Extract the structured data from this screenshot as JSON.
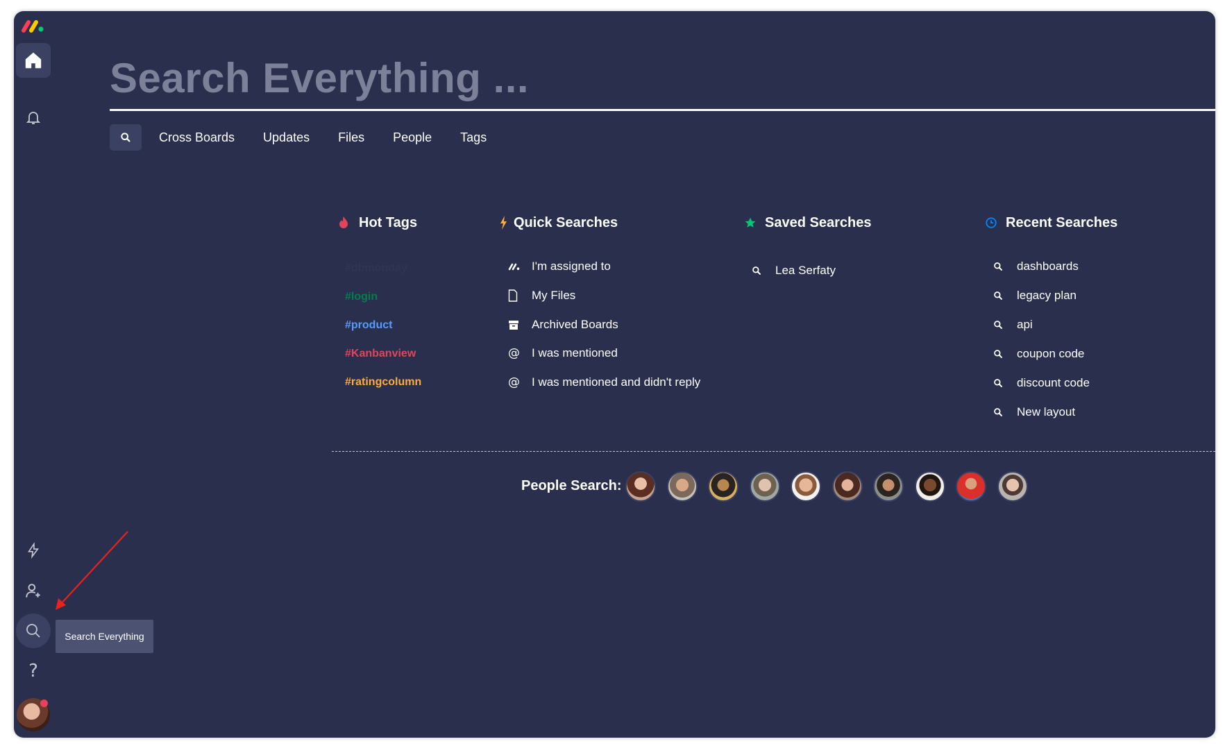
{
  "search": {
    "title": "Search Everything ..."
  },
  "filters": {
    "tabs": [
      "Cross Boards",
      "Updates",
      "Files",
      "People",
      "Tags"
    ]
  },
  "hot_tags": {
    "title": "Hot Tags",
    "tags": [
      {
        "label": "#dbmonday",
        "color": "#2f3552"
      },
      {
        "label": "#login",
        "color": "#037f4c"
      },
      {
        "label": "#product",
        "color": "#579bfc"
      },
      {
        "label": "#Kanbanview",
        "color": "#e2445c"
      },
      {
        "label": "#ratingcolumn",
        "color": "#fdab3d"
      }
    ]
  },
  "quick_searches": {
    "title": "Quick Searches",
    "items": [
      {
        "label": "I'm assigned to",
        "icon": "monday-logo-icon"
      },
      {
        "label": "My Files",
        "icon": "file-icon"
      },
      {
        "label": "Archived Boards",
        "icon": "archive-icon"
      },
      {
        "label": "I was mentioned",
        "icon": "at-icon"
      },
      {
        "label": "I was mentioned and didn't reply",
        "icon": "at-icon"
      }
    ]
  },
  "saved_searches": {
    "title": "Saved Searches",
    "items": [
      "Lea Serfaty"
    ]
  },
  "recent_searches": {
    "title": "Recent Searches",
    "items": [
      "dashboards",
      "legacy plan",
      "api",
      "coupon code",
      "discount code",
      "New layout"
    ]
  },
  "people_search": {
    "label": "People Search:",
    "count": 10
  },
  "tooltip": {
    "text": "Search Everything"
  },
  "colors": {
    "background": "#292f4c",
    "hot_tags_icon": "#e2445c",
    "quick_icon": "#fdab3d",
    "saved_icon": "#00c875",
    "recent_icon": "#0085ff",
    "annotation_arrow": "#e8231b"
  }
}
